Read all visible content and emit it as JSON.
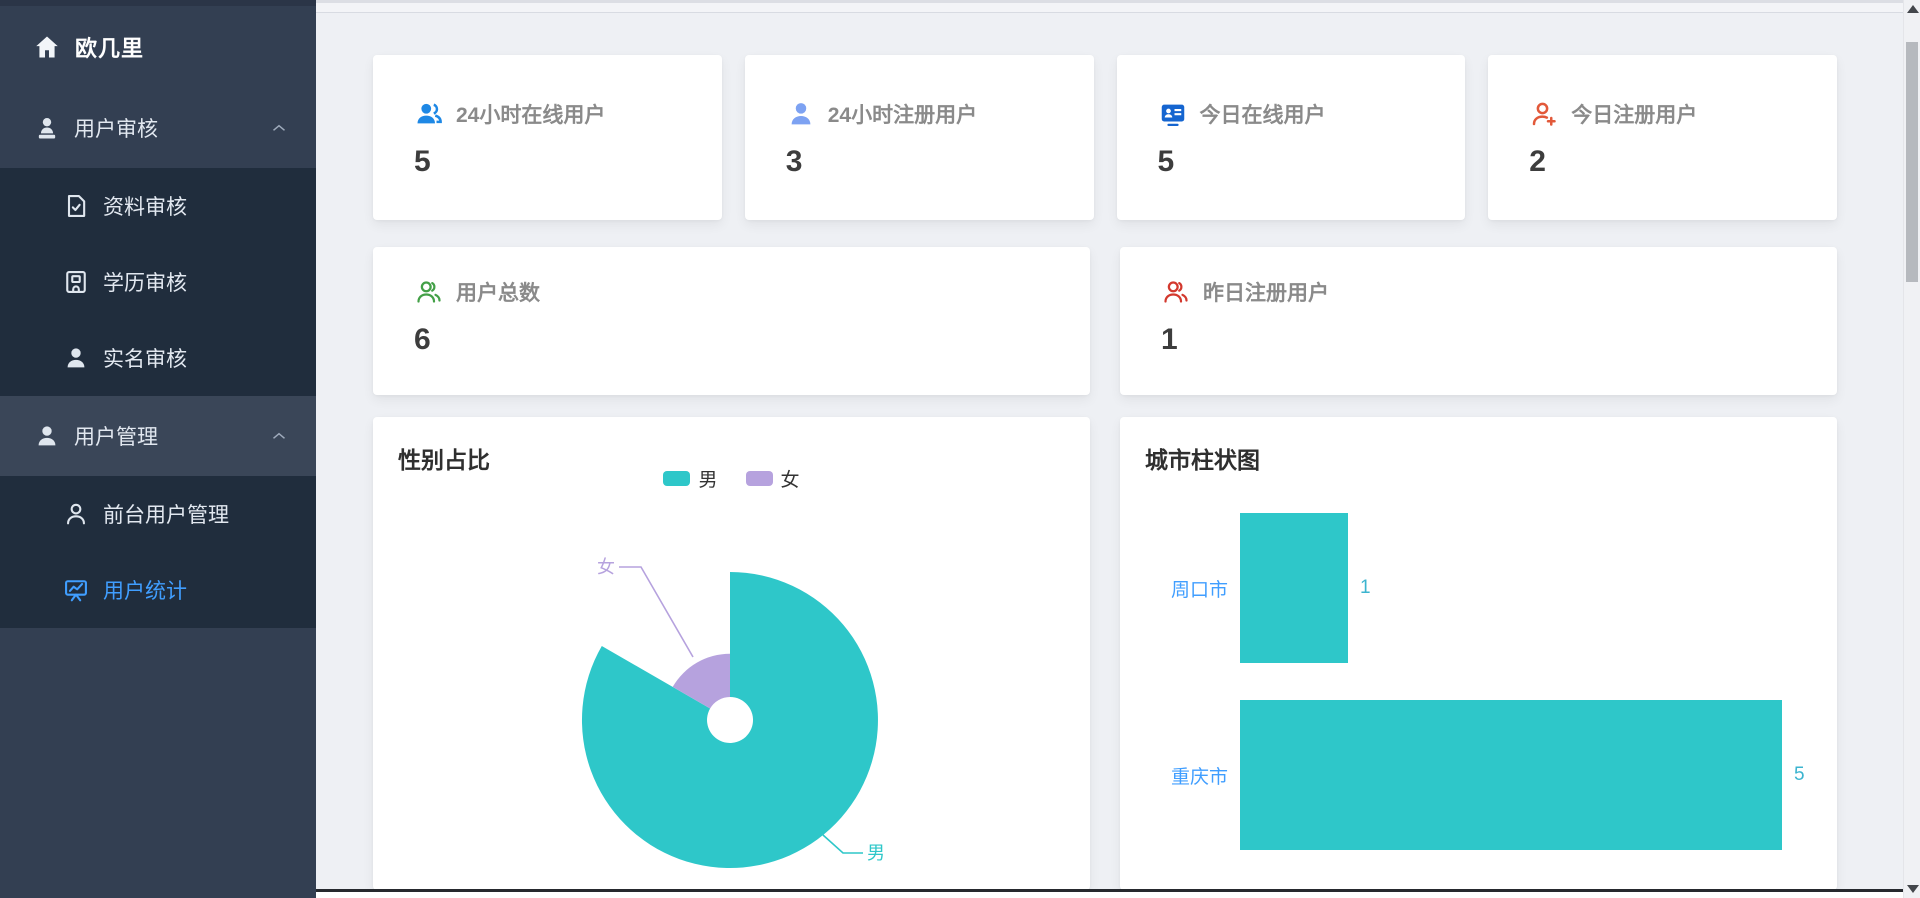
{
  "sidebar": {
    "logo": {
      "label": "欧几里"
    },
    "menu": [
      {
        "id": "user-audit",
        "label": "用户审核",
        "icon": "audit-stamp-icon",
        "kind": "parent",
        "chevron": true
      },
      {
        "id": "profile-audit",
        "label": "资料审核",
        "icon": "doc-check-icon",
        "kind": "sub"
      },
      {
        "id": "education-audit",
        "label": "学历审核",
        "icon": "school-icon",
        "kind": "sub"
      },
      {
        "id": "realname-audit",
        "label": "实名审核",
        "icon": "user-filled-icon",
        "kind": "sub"
      },
      {
        "id": "user-manage",
        "label": "用户管理",
        "icon": "user-filled-icon",
        "kind": "parent",
        "chevron": true,
        "highlight": true
      },
      {
        "id": "front-user-manage",
        "label": "前台用户管理",
        "icon": "user-outline-icon",
        "kind": "sub"
      },
      {
        "id": "user-stats",
        "label": "用户统计",
        "icon": "chart-board-icon",
        "kind": "sub",
        "active": true
      }
    ]
  },
  "stats": [
    {
      "id": "online-24h",
      "label": "24小时在线用户",
      "value": "5",
      "icon": "users-filled-icon",
      "color": "#1e88e5",
      "wide": false
    },
    {
      "id": "registered-24h",
      "label": "24小时注册用户",
      "value": "3",
      "icon": "user-filled-light-icon",
      "color": "#7da2f2",
      "wide": false
    },
    {
      "id": "online-today",
      "label": "今日在线用户",
      "value": "5",
      "icon": "id-card-icon",
      "color": "#1565d0",
      "wide": false
    },
    {
      "id": "registered-today",
      "label": "今日注册用户",
      "value": "2",
      "icon": "user-plus-icon",
      "color": "#e2593a",
      "wide": false
    },
    {
      "id": "total-users",
      "label": "用户总数",
      "value": "6",
      "icon": "users-outline-icon",
      "color": "#43a047",
      "wide": true
    },
    {
      "id": "registered-yesterday",
      "label": "昨日注册用户",
      "value": "1",
      "icon": "users-outline-red-icon",
      "color": "#d3392e",
      "wide": true
    }
  ],
  "chart_data": [
    {
      "type": "pie",
      "title": "性别占比",
      "style": "rose-donut",
      "legend_position": "top-center",
      "series": [
        {
          "name": "男",
          "value": 5,
          "color": "#2ec7c9"
        },
        {
          "name": "女",
          "value": 1,
          "color": "#b6a2de"
        }
      ]
    },
    {
      "type": "bar",
      "title": "城市柱状图",
      "orientation": "horizontal",
      "categories": [
        "周口市",
        "重庆市"
      ],
      "values": [
        1,
        5
      ],
      "xlim": [
        0,
        5
      ],
      "bar_color": "#2ec7c9",
      "category_label_color": "#409eff",
      "value_label_color": "#3bb4cf",
      "grid": false
    }
  ]
}
